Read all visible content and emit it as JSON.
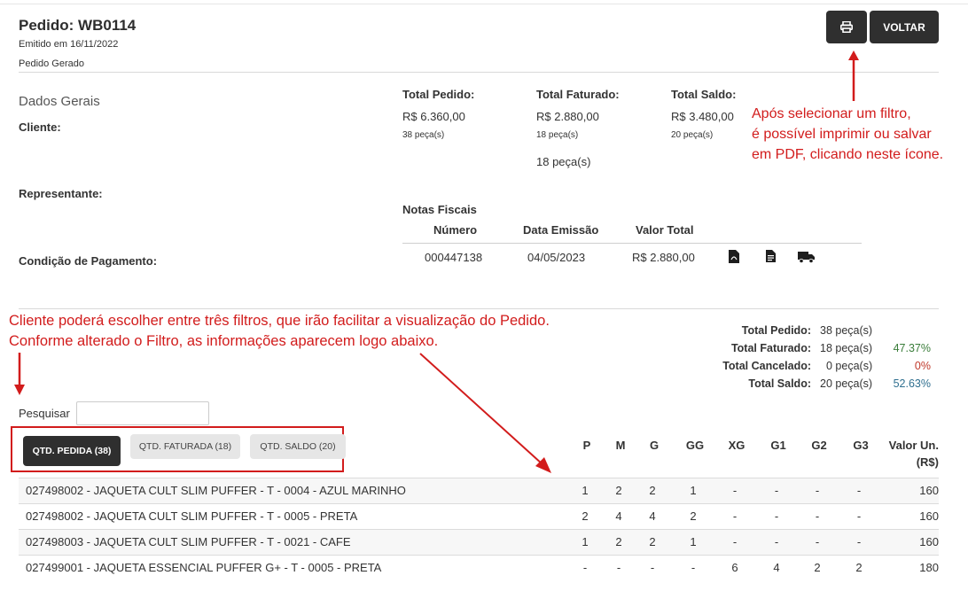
{
  "header": {
    "title": "Pedido: WB0114",
    "emitted": "Emitido em 16/11/2022",
    "status": "Pedido Gerado",
    "back_label": "VOLTAR"
  },
  "general": {
    "section_title": "Dados Gerais",
    "client_label": "Cliente:",
    "rep_label": "Representante:",
    "payment_label": "Condição de Pagamento:"
  },
  "totals_top": [
    {
      "label": "Total Pedido:",
      "value": "R$ 6.360,00",
      "pieces": "38 peça(s)"
    },
    {
      "label": "Total Faturado:",
      "value": "R$ 2.880,00",
      "pieces": "18 peça(s)",
      "extra": "18 peça(s)"
    },
    {
      "label": "Total Saldo:",
      "value": "R$ 3.480,00",
      "pieces": "20 peça(s)"
    }
  ],
  "invoices": {
    "title": "Notas Fiscais",
    "headers": [
      "Número",
      "Data Emissão",
      "Valor Total"
    ],
    "rows": [
      {
        "number": "000447138",
        "date": "04/05/2023",
        "total": "R$ 2.880,00"
      }
    ],
    "icons": [
      "pdf-icon",
      "document-icon",
      "truck-icon"
    ]
  },
  "annotations": {
    "print_note": [
      "Após selecionar um filtro,",
      "é possível imprimir ou salvar",
      "em PDF, clicando neste ícone."
    ],
    "filter_note": [
      "Cliente poderá escolher entre três filtros, que irão facilitar a visualização do Pedido.",
      "Conforme alterado o Filtro, as informações aparecem logo abaixo."
    ],
    "color": "#d21c1c"
  },
  "summary": [
    {
      "label": "Total Pedido:",
      "value": "38 peça(s)",
      "pct": ""
    },
    {
      "label": "Total Faturado:",
      "value": "18 peça(s)",
      "pct": "47.37%",
      "pct_color": "#3a7d3a"
    },
    {
      "label": "Total Cancelado:",
      "value": "0 peça(s)",
      "pct": "0%",
      "pct_color": "#c0392b"
    },
    {
      "label": "Total Saldo:",
      "value": "20 peça(s)",
      "pct": "52.63%",
      "pct_color": "#2f6f8f"
    }
  ],
  "search": {
    "label": "Pesquisar",
    "value": "",
    "placeholder": ""
  },
  "filters": [
    {
      "label": "QTD. PEDIDA (38)",
      "active": true
    },
    {
      "label": "QTD. FATURADA (18)",
      "active": false
    },
    {
      "label": "QTD. SALDO (20)",
      "active": false
    }
  ],
  "table": {
    "size_headers": [
      "P",
      "M",
      "G",
      "GG",
      "XG",
      "G1",
      "G2",
      "G3"
    ],
    "price_header_1": "Valor Un.",
    "price_header_2": "(R$)",
    "rows": [
      {
        "name": "027498002 - JAQUETA CULT SLIM PUFFER - T - 0004 - AZUL MARINHO",
        "sizes": [
          "1",
          "2",
          "2",
          "1",
          "-",
          "-",
          "-",
          "-"
        ],
        "price": "160"
      },
      {
        "name": "027498002 - JAQUETA CULT SLIM PUFFER - T - 0005 - PRETA",
        "sizes": [
          "2",
          "4",
          "4",
          "2",
          "-",
          "-",
          "-",
          "-"
        ],
        "price": "160"
      },
      {
        "name": "027498003 - JAQUETA CULT SLIM PUFFER - T - 0021 - CAFE",
        "sizes": [
          "1",
          "2",
          "2",
          "1",
          "-",
          "-",
          "-",
          "-"
        ],
        "price": "160"
      },
      {
        "name": "027499001 - JAQUETA ESSENCIAL PUFFER G+ - T - 0005 - PRETA",
        "sizes": [
          "-",
          "-",
          "-",
          "-",
          "6",
          "4",
          "2",
          "2"
        ],
        "price": "180"
      }
    ]
  }
}
